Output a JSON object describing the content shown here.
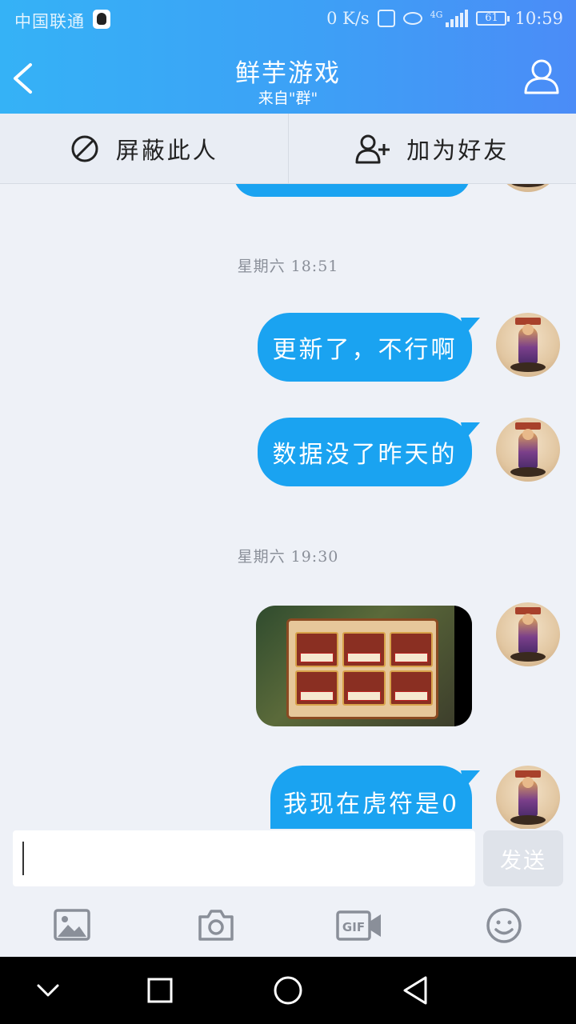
{
  "status_bar": {
    "carrier": "中国联通",
    "speed": "0 K/s",
    "network": "4G",
    "battery": "61",
    "time": "10:59"
  },
  "header": {
    "title": "鲜芋游戏",
    "subtitle": "来自\"群\""
  },
  "actions": {
    "block_label": "屏蔽此人",
    "add_friend_label": "加为好友"
  },
  "messages": [
    {
      "type": "time",
      "text": "星期六 18:51"
    },
    {
      "type": "text",
      "text": "更新了，不行啊"
    },
    {
      "type": "text",
      "text": "数据没了昨天的"
    },
    {
      "type": "time",
      "text": "星期六 19:30"
    },
    {
      "type": "image"
    },
    {
      "type": "text",
      "text": "我现在虎符是0"
    }
  ],
  "composer": {
    "input_value": "",
    "send_label": "发送"
  },
  "toolbar": {
    "icons": [
      "image-icon",
      "camera-icon",
      "gif-icon",
      "emoji-icon"
    ]
  },
  "colors": {
    "header": "#3da0f6",
    "bubble": "#1aa3f1",
    "background": "#eef1f7"
  }
}
